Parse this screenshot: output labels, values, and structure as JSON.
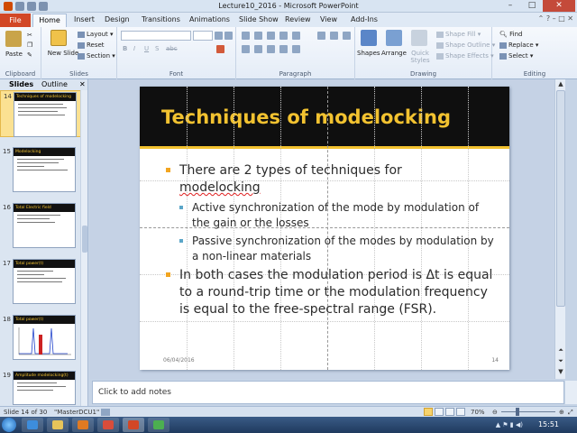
{
  "window": {
    "title": "Lecture10_2016 - Microsoft PowerPoint"
  },
  "tabs": [
    "File",
    "Home",
    "Insert",
    "Design",
    "Transitions",
    "Animations",
    "Slide Show",
    "Review",
    "View",
    "Add-Ins"
  ],
  "ribbon": {
    "clipboard": {
      "label": "Clipboard",
      "paste": "Paste"
    },
    "slides": {
      "label": "Slides",
      "new_slide": "New Slide",
      "layout": "Layout",
      "reset": "Reset",
      "section": "Section"
    },
    "font": {
      "label": "Font"
    },
    "paragraph": {
      "label": "Paragraph"
    },
    "drawing": {
      "label": "Drawing",
      "shapes": "Shapes",
      "arrange": "Arrange",
      "quick_styles": "Quick Styles",
      "shape_fill": "Shape Fill",
      "shape_outline": "Shape Outline",
      "shape_effects": "Shape Effects"
    },
    "editing": {
      "label": "Editing",
      "find": "Find",
      "replace": "Replace",
      "select": "Select"
    }
  },
  "panel": {
    "tabs": [
      "Slides",
      "Outline"
    ],
    "thumbnails": [
      {
        "num": "14",
        "title": "Techniques of modelocking"
      },
      {
        "num": "15",
        "title": "Modelocking"
      },
      {
        "num": "16",
        "title": "Total Electric field"
      },
      {
        "num": "17",
        "title": "Total power(t)"
      },
      {
        "num": "18",
        "title": "Total power(t)"
      },
      {
        "num": "19",
        "title": "Amplitude modelocking(t)"
      }
    ]
  },
  "slide": {
    "title": "Techniques of modelocking",
    "bullet1_part1": "There are 2 types of techniques for",
    "bullet1_part2": "modelocking",
    "sub1": "Active synchronization of the mode by modulation of the gain or the losses",
    "sub2": "Passive synchronization of the modes by modulation by a non-linear materials",
    "bullet2": "In both cases the modulation period is Δt is equal to a round-trip time or the modulation frequency is equal to the free-spectral range (FSR).",
    "date": "06/04/2016",
    "number": "14"
  },
  "notes": {
    "placeholder": "Click to add notes"
  },
  "status": {
    "slide_info": "Slide 14 of 30",
    "theme": "\"MasterDCU1\"",
    "zoom": "70%"
  },
  "taskbar": {
    "time": "15:51"
  },
  "colors": {
    "accent": "#f2c230",
    "file_tab": "#d24726",
    "selected_thumb": "#fbe192"
  }
}
